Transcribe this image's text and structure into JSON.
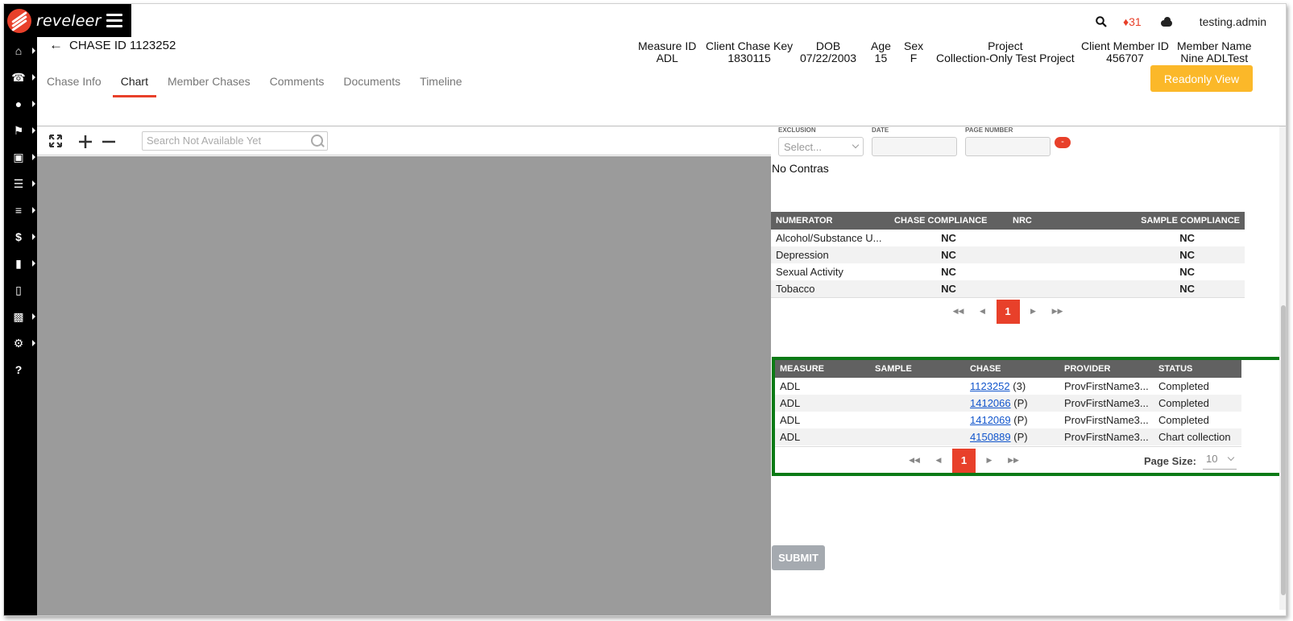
{
  "brand": {
    "name": "reveleer"
  },
  "topbar": {
    "notification_count": "31",
    "username": "testing.admin"
  },
  "chase": {
    "title": "CHASE ID 1123252"
  },
  "meta": [
    {
      "label": "Measure ID",
      "value": "ADL"
    },
    {
      "label": "Client Chase Key",
      "value": "1830115"
    },
    {
      "label": "DOB",
      "value": "07/22/2003"
    },
    {
      "label": "Age",
      "value": "15"
    },
    {
      "label": "Sex",
      "value": "F"
    },
    {
      "label": "Project",
      "value": "Collection-Only Test Project"
    },
    {
      "label": "Client Member ID",
      "value": "456707"
    },
    {
      "label": "Member Name",
      "value": "Nine ADLTest"
    }
  ],
  "tabs": [
    {
      "label": "Chase Info"
    },
    {
      "label": "Chart"
    },
    {
      "label": "Member Chases"
    },
    {
      "label": "Comments"
    },
    {
      "label": "Documents"
    },
    {
      "label": "Timeline"
    }
  ],
  "readonly_label": "Readonly View",
  "viewer": {
    "search_placeholder": "Search Not Available Yet"
  },
  "exclusion_form": {
    "labels": {
      "exclusion": "EXCLUSION",
      "date": "DATE",
      "page_number": "PAGE NUMBER"
    },
    "select_placeholder": "Select...",
    "remove_label": "-",
    "no_contras": "No Contras"
  },
  "numerator_table": {
    "headers": [
      "NUMERATOR",
      "CHASE COMPLIANCE",
      "NRC",
      "SAMPLE COMPLIANCE"
    ],
    "rows": [
      {
        "numerator": "Alcohol/Substance U...",
        "chase": "NC",
        "nrc": "",
        "sample": "NC"
      },
      {
        "numerator": "Depression",
        "chase": "NC",
        "nrc": "",
        "sample": "NC"
      },
      {
        "numerator": "Sexual Activity",
        "chase": "NC",
        "nrc": "",
        "sample": "NC"
      },
      {
        "numerator": "Tobacco",
        "chase": "NC",
        "nrc": "",
        "sample": "NC"
      }
    ],
    "page": "1"
  },
  "chase_table": {
    "headers": [
      "MEASURE",
      "SAMPLE",
      "CHASE",
      "PROVIDER",
      "STATUS"
    ],
    "rows": [
      {
        "measure": "ADL",
        "sample": "",
        "chase_id": "1123252",
        "chase_suffix": " (3)",
        "provider": "ProvFirstName3...",
        "status": "Completed"
      },
      {
        "measure": "ADL",
        "sample": "",
        "chase_id": "1412066",
        "chase_suffix": " (P)",
        "provider": "ProvFirstName3...",
        "status": "Completed"
      },
      {
        "measure": "ADL",
        "sample": "",
        "chase_id": "1412069",
        "chase_suffix": " (P)",
        "provider": "ProvFirstName3...",
        "status": "Completed"
      },
      {
        "measure": "ADL",
        "sample": "",
        "chase_id": "4150889",
        "chase_suffix": " (P)",
        "provider": "ProvFirstName3...",
        "status": "Chart collection"
      }
    ],
    "page": "1",
    "page_size_label": "Page Size:",
    "page_size": "10"
  },
  "submit_label": "SUBMIT",
  "colors": {
    "accent": "#e8402a",
    "readonly": "#fbb829",
    "highlight": "#0a7a15",
    "viewer_bg": "#9b9b9b"
  }
}
